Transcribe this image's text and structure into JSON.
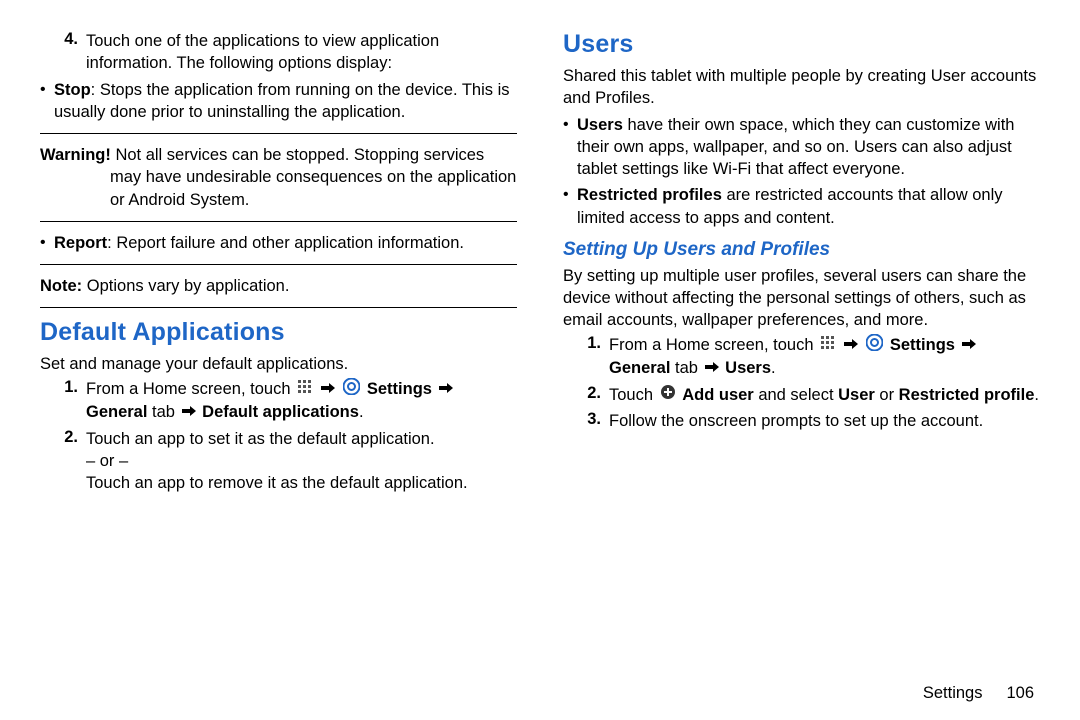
{
  "left": {
    "step4_num": "4.",
    "step4_text": "Touch one of the applications to view application information. The following options display:",
    "stop_label": "Stop",
    "stop_text": ": Stops the application from running on the device. This is usually done prior to uninstalling the application.",
    "warning_label": "Warning!",
    "warning_body1": " Not all services can be stopped. Stopping services",
    "warning_body2": "may have undesirable consequences on the application or Android System.",
    "report_label": "Report",
    "report_text": ": Report failure and other application information.",
    "note_label": "Note:",
    "note_text": " Options vary by application.",
    "heading_default": "Default Applications",
    "default_intro": "Set and manage your default applications.",
    "d1_num": "1.",
    "d1_pre": "From a Home screen, touch ",
    "d1_settings": " Settings ",
    "d1_line2a": "General",
    "d1_line2b": " tab ",
    "d1_line2c": " Default applications",
    "d1_period": ".",
    "d2_num": "2.",
    "d2_text": "Touch an app to set it as the default application.",
    "d2_or": "– or –",
    "d2_alt": "Touch an app to remove it as the default application."
  },
  "right": {
    "heading_users": "Users",
    "users_intro": "Shared this tablet with multiple people by creating User accounts and Profiles.",
    "u_bullet1_label": "Users",
    "u_bullet1_text": " have their own space, which they can customize with their own apps, wallpaper, and so on. Users can also adjust tablet settings like Wi-Fi that affect everyone.",
    "u_bullet2_label": "Restricted profiles",
    "u_bullet2_text": " are restricted accounts that allow only limited access to apps and content.",
    "heading_setup": "Setting Up Users and Profiles",
    "setup_intro": "By setting up multiple user profiles, several users can share the device without affecting the personal settings of others, such as email accounts, wallpaper preferences, and more.",
    "s1_num": "1.",
    "s1_pre": "From a Home screen, touch ",
    "s1_settings": " Settings ",
    "s1_line2a": "General",
    "s1_line2b": " tab ",
    "s1_line2c": " Users",
    "s1_period": ".",
    "s2_num": "2.",
    "s2_pre": "Touch ",
    "s2_add": " Add user",
    "s2_mid": " and select ",
    "s2_user": "User",
    "s2_or": " or ",
    "s2_rest": "Restricted profile",
    "s2_period": ".",
    "s3_num": "3.",
    "s3_text": "Follow the onscreen prompts to set up the account."
  },
  "footer": {
    "section": "Settings",
    "page": "106"
  }
}
